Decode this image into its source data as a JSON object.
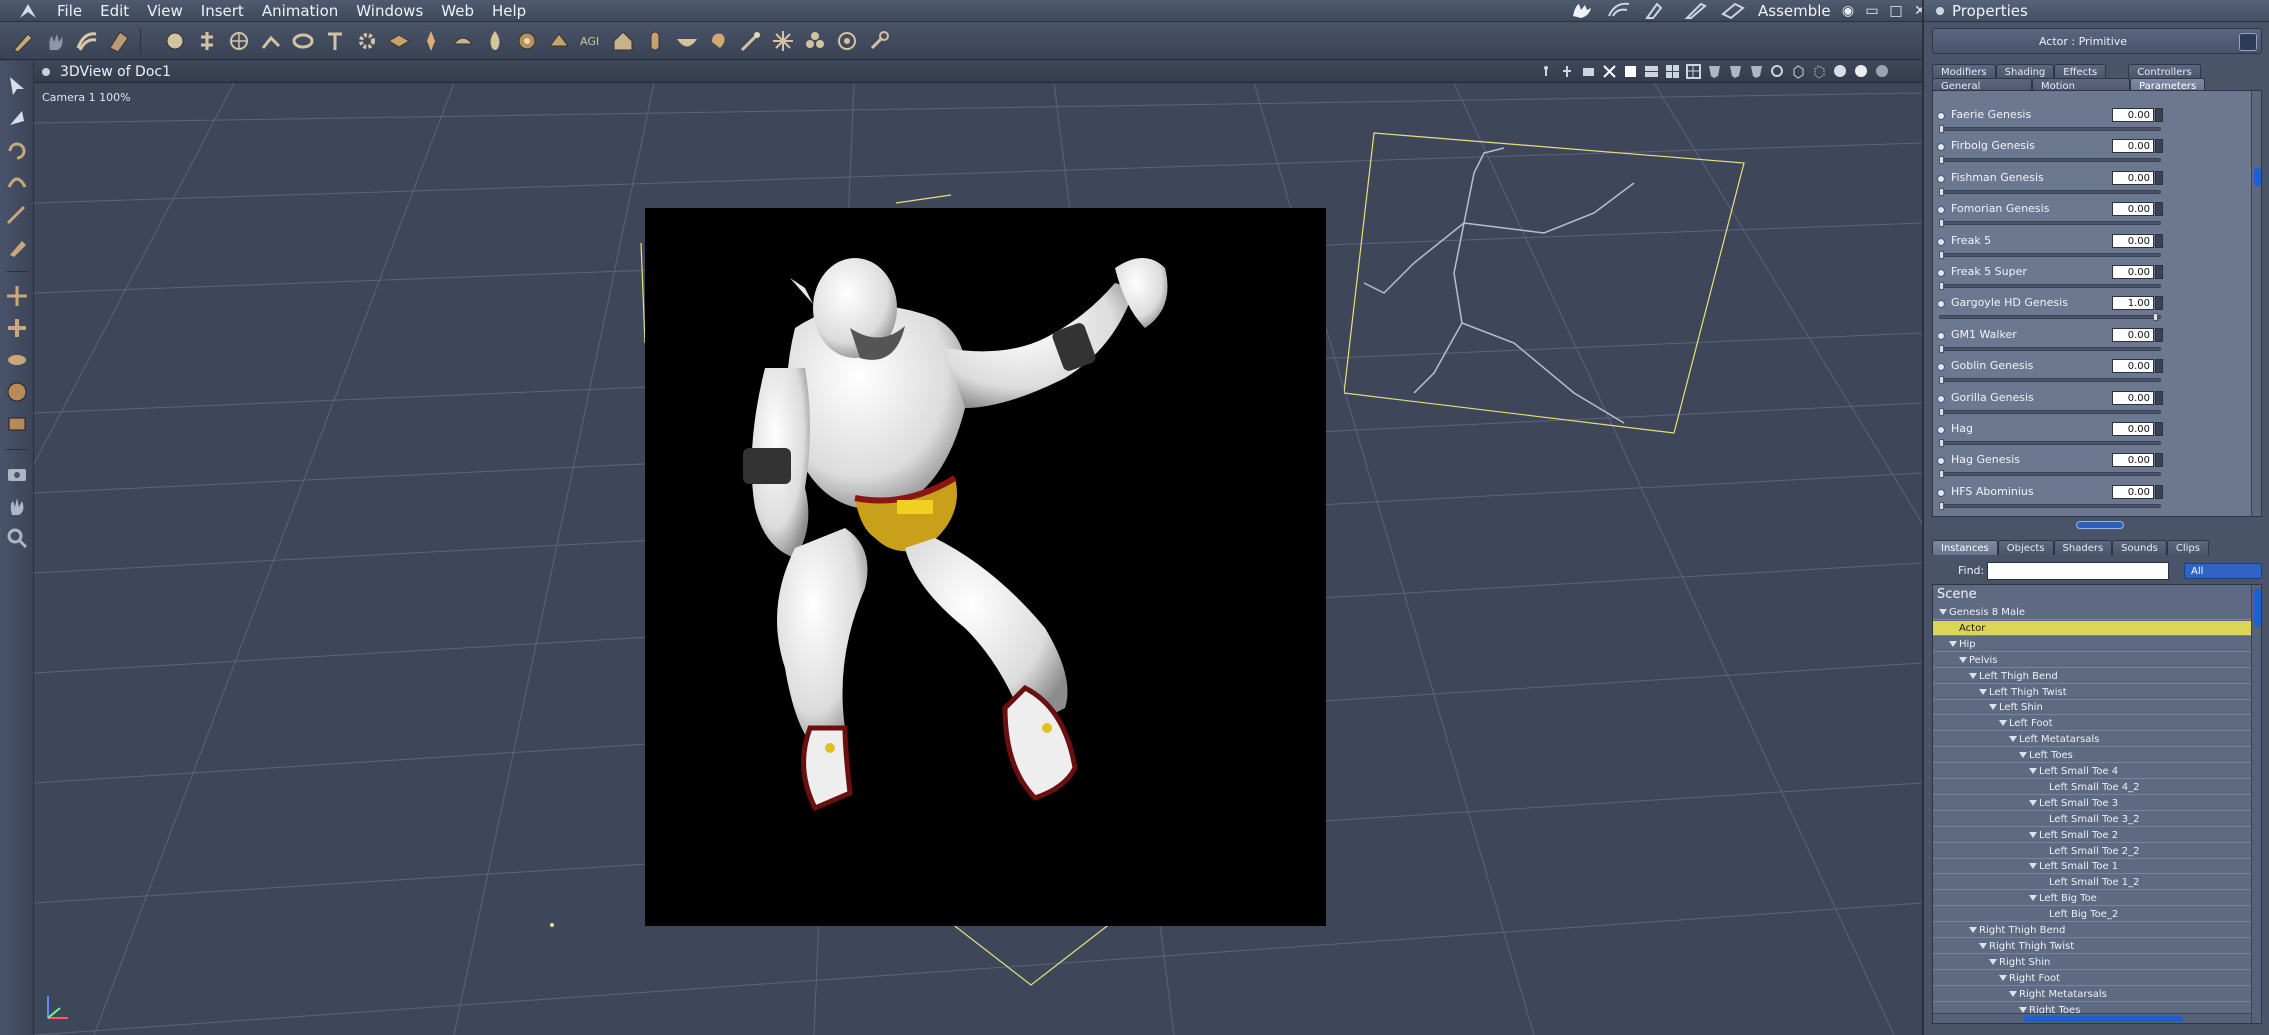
{
  "menubar": {
    "items": [
      "File",
      "Edit",
      "View",
      "Insert",
      "Animation",
      "Windows",
      "Web",
      "Help"
    ],
    "room": "Assemble",
    "window_controls": [
      "◉",
      "▭",
      "□",
      "✕"
    ]
  },
  "viewport": {
    "title": "3DView of Doc1",
    "camera_label": "Camera 1 100%"
  },
  "properties": {
    "title": "Properties",
    "actor": "Actor : Primitive",
    "tabs_top": [
      "Modifiers",
      "Shading",
      "Effects",
      "Controllers"
    ],
    "tabs_bottom": [
      "General",
      "Motion",
      "Parameters"
    ],
    "active_tab": "Parameters",
    "parameters": [
      {
        "name": "Faerie Genesis",
        "value": "0.00",
        "knob": 0.0
      },
      {
        "name": "Firbolg Genesis",
        "value": "0.00",
        "knob": 0.0
      },
      {
        "name": "Fishman Genesis",
        "value": "0.00",
        "knob": 0.0
      },
      {
        "name": "Fomorian Genesis",
        "value": "0.00",
        "knob": 0.0
      },
      {
        "name": "Freak 5",
        "value": "0.00",
        "knob": 0.0
      },
      {
        "name": "Freak 5 Super",
        "value": "0.00",
        "knob": 0.0
      },
      {
        "name": "Gargoyle HD Genesis",
        "value": "1.00",
        "knob": 1.0
      },
      {
        "name": "GM1 Walker",
        "value": "0.00",
        "knob": 0.0
      },
      {
        "name": "Goblin Genesis",
        "value": "0.00",
        "knob": 0.0
      },
      {
        "name": "Gorilla Genesis",
        "value": "0.00",
        "knob": 0.0
      },
      {
        "name": "Hag",
        "value": "0.00",
        "knob": 0.0
      },
      {
        "name": "Hag Genesis",
        "value": "0.00",
        "knob": 0.0
      },
      {
        "name": "HFS Abominius",
        "value": "0.00",
        "knob": 0.0
      }
    ]
  },
  "scene_panel": {
    "tabs": [
      "Instances",
      "Objects",
      "Shaders",
      "Sounds",
      "Clips"
    ],
    "active_tab": "Instances",
    "find_label": "Find:",
    "find_value": "",
    "filter_value": "All",
    "scene_label": "Scene",
    "tree": [
      {
        "label": "Genesis 8 Male",
        "depth": 0,
        "arrow": true
      },
      {
        "label": "Actor",
        "depth": 1,
        "arrow": false,
        "selected": true
      },
      {
        "label": "Hip",
        "depth": 1,
        "arrow": true
      },
      {
        "label": "Pelvis",
        "depth": 2,
        "arrow": true
      },
      {
        "label": "Left Thigh Bend",
        "depth": 3,
        "arrow": true
      },
      {
        "label": "Left Thigh Twist",
        "depth": 4,
        "arrow": true
      },
      {
        "label": "Left Shin",
        "depth": 5,
        "arrow": true
      },
      {
        "label": "Left Foot",
        "depth": 6,
        "arrow": true
      },
      {
        "label": "Left Metatarsals",
        "depth": 7,
        "arrow": true
      },
      {
        "label": "Left Toes",
        "depth": 8,
        "arrow": true
      },
      {
        "label": "Left Small Toe 4",
        "depth": 9,
        "arrow": true
      },
      {
        "label": "Left Small Toe 4_2",
        "depth": 10,
        "arrow": false
      },
      {
        "label": "Left Small Toe 3",
        "depth": 9,
        "arrow": true
      },
      {
        "label": "Left Small Toe 3_2",
        "depth": 10,
        "arrow": false
      },
      {
        "label": "Left Small Toe 2",
        "depth": 9,
        "arrow": true
      },
      {
        "label": "Left Small Toe 2_2",
        "depth": 10,
        "arrow": false
      },
      {
        "label": "Left Small Toe 1",
        "depth": 9,
        "arrow": true
      },
      {
        "label": "Left Small Toe 1_2",
        "depth": 10,
        "arrow": false
      },
      {
        "label": "Left Big Toe",
        "depth": 9,
        "arrow": true
      },
      {
        "label": "Left Big Toe_2",
        "depth": 10,
        "arrow": false
      },
      {
        "label": "Right Thigh Bend",
        "depth": 3,
        "arrow": true
      },
      {
        "label": "Right Thigh Twist",
        "depth": 4,
        "arrow": true
      },
      {
        "label": "Right Shin",
        "depth": 5,
        "arrow": true
      },
      {
        "label": "Right Foot",
        "depth": 6,
        "arrow": true
      },
      {
        "label": "Right Metatarsals",
        "depth": 7,
        "arrow": true
      },
      {
        "label": "Right Toes",
        "depth": 8,
        "arrow": true
      }
    ]
  },
  "toolbar": {
    "tools": [
      "pencil-icon",
      "hand-icon",
      "hair-icon",
      "cloth-icon",
      "sphere-icon",
      "hierarchy-icon",
      "globe-icon",
      "bones-icon",
      "ring-icon",
      "text-icon",
      "gear-icon",
      "layer-icon",
      "light-icon",
      "camera-icon",
      "flame-icon",
      "prop-icon",
      "agi-icon",
      "house-icon",
      "tube-icon",
      "bowl-icon",
      "bulb-icon",
      "wand-icon",
      "spark-icon",
      "group-icon",
      "target-icon",
      "pin-icon"
    ],
    "agi_label": "AGI"
  },
  "colors": {
    "accent_blue": "#2f63c4",
    "selected_row": "#dcd657",
    "grid": "#5a6478",
    "guide_yellow": "#e8e07a"
  }
}
